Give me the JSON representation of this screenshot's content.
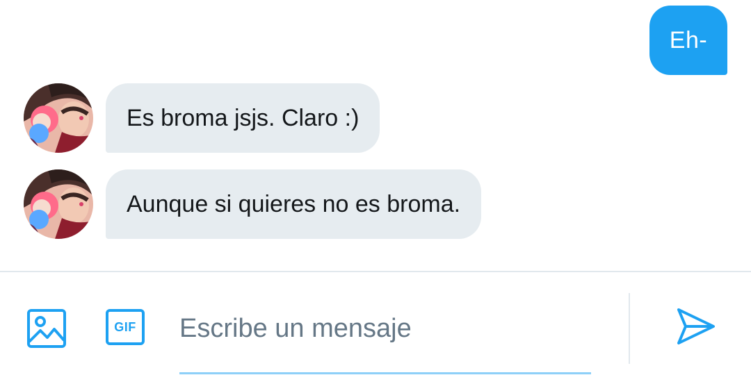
{
  "thread": {
    "outgoing": [
      {
        "text": "Eh-"
      }
    ],
    "incoming": [
      {
        "text": "Es broma jsjs. Claro :)"
      },
      {
        "text": "Aunque si quieres no es broma."
      }
    ]
  },
  "composer": {
    "placeholder": "Escribe un mensaje",
    "value": "",
    "gif_label": "GIF",
    "icons": {
      "photo": "image-icon",
      "gif": "gif-icon",
      "send": "send-icon"
    }
  },
  "colors": {
    "accent": "#1da1f2",
    "incoming_bubble": "#e6ecf0",
    "text": "#14171a",
    "placeholder": "#657786",
    "divider": "#e1e8ed"
  }
}
